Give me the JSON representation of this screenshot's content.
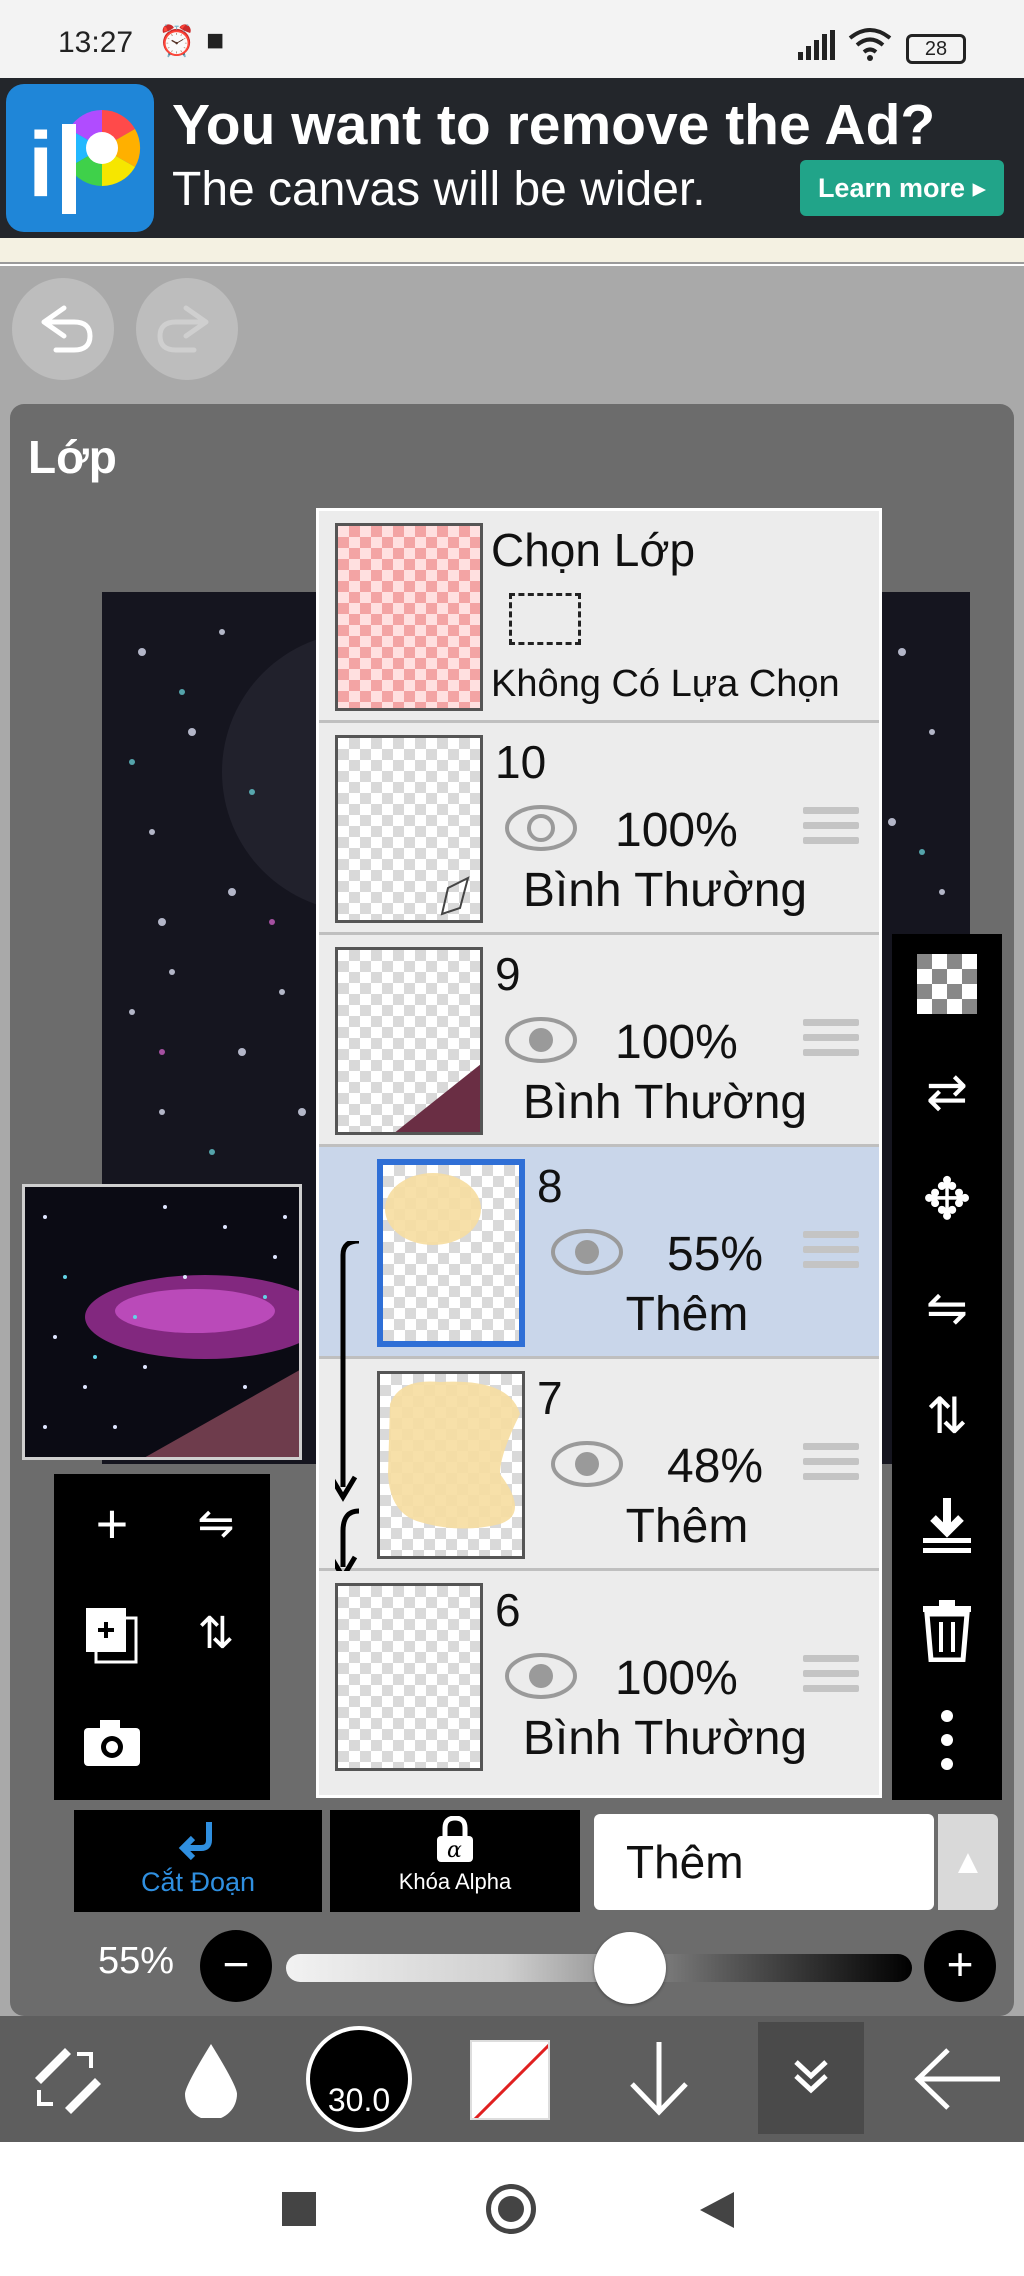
{
  "status_bar": {
    "time": "13:27",
    "battery": "28"
  },
  "ad": {
    "headline": "You want to remove the Ad?",
    "subline": "The canvas will be wider.",
    "learn_more": "Learn more"
  },
  "panel": {
    "title": "Lớp"
  },
  "layers": [
    {
      "kind": "selection",
      "title": "Chọn Lớp",
      "status": "Không Có Lựa Chọn"
    },
    {
      "number": "10",
      "opacity": "100%",
      "blend": "Bình Thường",
      "selected": false
    },
    {
      "number": "9",
      "opacity": "100%",
      "blend": "Bình Thường",
      "selected": false
    },
    {
      "number": "8",
      "opacity": "55%",
      "blend": "Thêm",
      "selected": true
    },
    {
      "number": "7",
      "opacity": "48%",
      "blend": "Thêm",
      "selected": false
    },
    {
      "number": "6",
      "opacity": "100%",
      "blend": "Bình Thường",
      "selected": false
    }
  ],
  "controls": {
    "clipping_label": "Cắt Đoạn",
    "alpha_lock_label": "Khóa Alpha",
    "blend_mode": "Thêm",
    "opacity_label": "55%",
    "opacity_value": 0.55,
    "brush_size": "30.0"
  },
  "colors": {
    "ad_bg": "#23262b",
    "learn_more_bg": "#21a489",
    "selected_layer_bg": "#c9d6ea",
    "clipping_accent": "#2f8fe0",
    "panel_bg": "#6c6c6c",
    "toolbar_bg": "#5e5e5e"
  },
  "icons": {
    "right_tools": [
      "checker-icon",
      "swap-layers-icon",
      "move-icon",
      "flip-horizontal-icon",
      "flip-vertical-icon",
      "merge-down-icon",
      "trash-icon",
      "more-vertical-icon"
    ],
    "left_tools": [
      "add-layer-icon",
      "flip-horizontal-icon",
      "add-layer-copy-icon",
      "flip-vertical-icon",
      "camera-icon"
    ],
    "toolbar": [
      "brush-eraser-swap-icon",
      "dropper-icon",
      "brush-size-icon",
      "color-icon",
      "down-arrow-icon",
      "layer-panel-icon",
      "back-arrow-icon"
    ]
  }
}
